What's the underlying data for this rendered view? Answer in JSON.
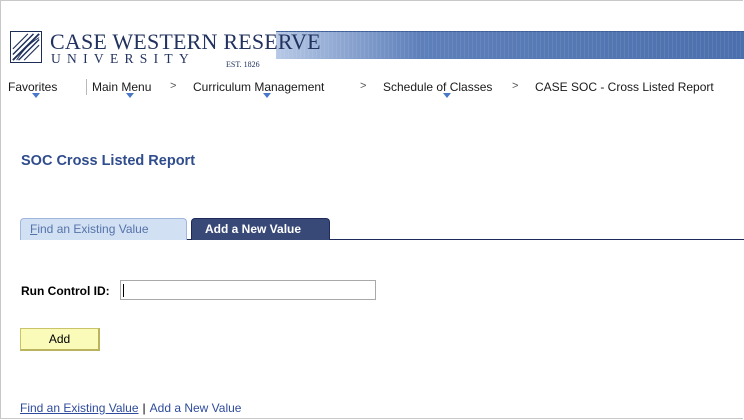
{
  "logo": {
    "name": "CASE WESTERN RESERVE",
    "university": "UNIVERSITY",
    "est": "EST. 1826"
  },
  "nav": {
    "favorites": "Favorites",
    "main_menu": "Main Menu",
    "curriculum": "Curriculum Management",
    "schedule": "Schedule of Classes",
    "current": "CASE SOC - Cross Listed Report",
    "separator": ">"
  },
  "page": {
    "title": "SOC Cross Listed Report"
  },
  "tabs": {
    "find_prefix": "F",
    "find_rest": "ind an Existing Value",
    "add": "Add a New Value"
  },
  "form": {
    "run_control_label": "Run Control ID:",
    "run_control_value": "",
    "add_button": "Add"
  },
  "footer": {
    "find_link": "Find an Existing Value",
    "divider": "|",
    "add_link": "Add a New Value"
  },
  "colors": {
    "title": "#2f4c8c",
    "active_tab": "#384978",
    "inactive_tab": "#d2e0f4",
    "button": "#fafbb9"
  }
}
